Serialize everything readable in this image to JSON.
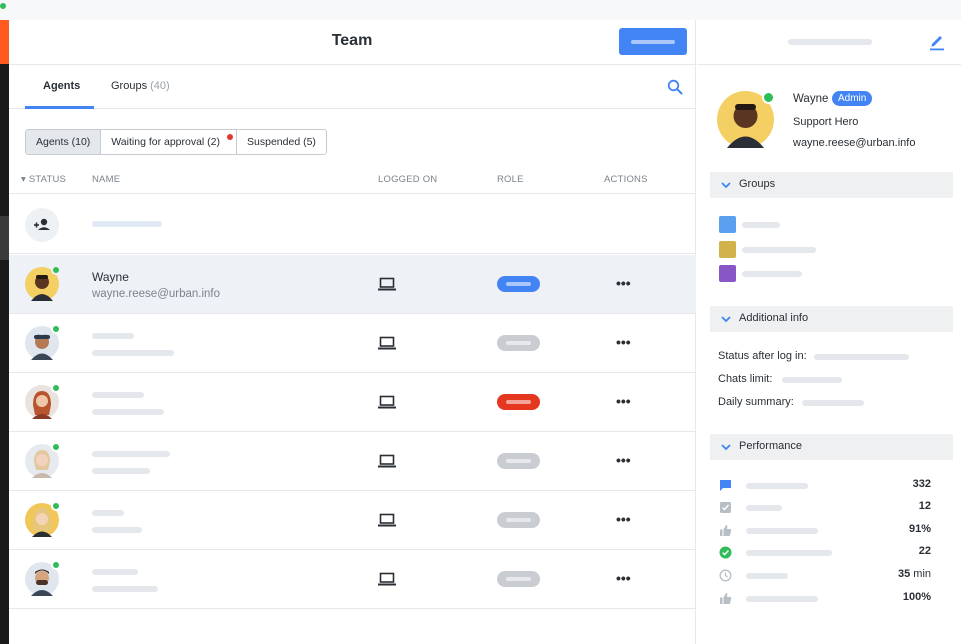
{
  "header": {
    "title": "Team"
  },
  "tabs": [
    {
      "label": "Agents",
      "count": ""
    },
    {
      "label": "Groups",
      "count": "(40)"
    }
  ],
  "filters": [
    {
      "label": "Agents (10)"
    },
    {
      "label": "Waiting for approval (2)"
    },
    {
      "label": "Suspended (5)"
    }
  ],
  "table": {
    "columns": [
      "STATUS",
      "NAME",
      "LOGGED ON",
      "ROLE",
      "ACTIONS"
    ],
    "rows": [
      {
        "name": "Wayne",
        "email": "wayne.reese@urban.info",
        "role_color": "#4384f5"
      },
      {
        "role_color": "#c9cdd2"
      },
      {
        "role_color": "#e5361f"
      },
      {
        "role_color": "#c9cdd2"
      },
      {
        "role_color": "#c9cdd2"
      },
      {
        "role_color": "#c9cdd2"
      }
    ],
    "actions_glyph": "•••"
  },
  "profile": {
    "name": "Wayne",
    "badge": "Admin",
    "role": "Support Hero",
    "email": "wayne.reese@urban.info"
  },
  "sections": {
    "groups": "Groups",
    "additional": "Additional info",
    "performance": "Performance"
  },
  "group_colors": [
    "#5a9ff0",
    "#d2b24a",
    "#8856c7"
  ],
  "additional_info": {
    "status_after_login": "Status after log in:",
    "chats_limit": "Chats limit:",
    "daily_summary": "Daily summary:"
  },
  "performance": [
    {
      "icon": "chat-icon",
      "value": "332",
      "unit": ""
    },
    {
      "icon": "checkbox-icon",
      "value": "12",
      "unit": ""
    },
    {
      "icon": "thumbs-up-icon",
      "value": "91%",
      "unit": ""
    },
    {
      "icon": "check-circle-icon",
      "value": "22",
      "unit": ""
    },
    {
      "icon": "clock-icon",
      "value": "35",
      "unit": " min"
    },
    {
      "icon": "thumbs-up-icon",
      "value": "100%",
      "unit": ""
    }
  ],
  "colors": {
    "accent": "#4384f5",
    "online": "#2fbc59",
    "alert": "#e5362d"
  }
}
